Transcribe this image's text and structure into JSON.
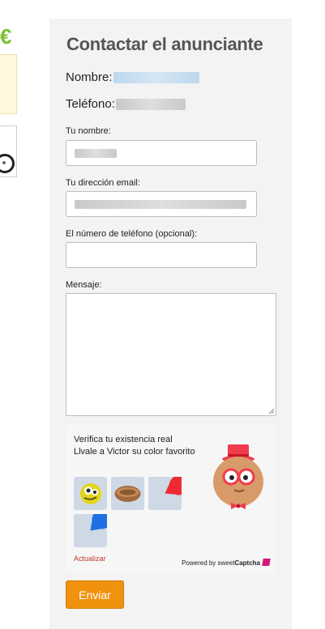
{
  "left": {
    "price_symbol": "€"
  },
  "contact": {
    "title": "Contactar el anunciante",
    "name_label": "Nombre:",
    "phone_label": "Teléfono:"
  },
  "form": {
    "name_label": "Tu nombre:",
    "email_label": "Tu dirección email:",
    "phone_label": "El número de teléfono (opcional):",
    "message_label": "Mensaje:",
    "phone_value": "",
    "message_value": ""
  },
  "captcha": {
    "line1": "Verifica tu existencia real",
    "line2": "Llvale a Victor su color favorito",
    "refresh_label": "Actualizar",
    "powered_prefix": "Powered by sweet",
    "powered_brand": "Captcha",
    "options": [
      "yellow-ball-icon",
      "wooden-bowl-icon",
      "red-pacman-icon",
      "blue-pacman-icon"
    ],
    "mascot": "victor-mascot-icon"
  },
  "submit_label": "Enviar",
  "colors": {
    "panel_bg": "#f3f3f3",
    "accent_orange": "#f0920e",
    "price_green": "#7cbf2f",
    "refresh_red": "#c0392b"
  }
}
